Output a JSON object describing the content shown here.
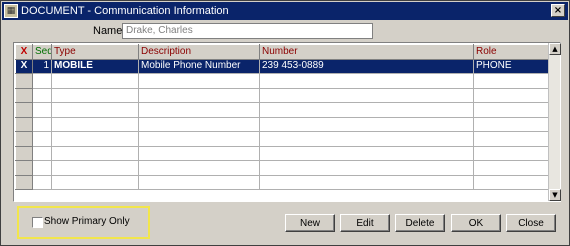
{
  "window": {
    "title": "DOCUMENT - Communication Information",
    "close": "×"
  },
  "name": {
    "label": "Name",
    "value": "Drake, Charles"
  },
  "grid": {
    "columns": {
      "x": "X",
      "seq": "Seq",
      "type": "Type",
      "description": "Description",
      "number": "Number",
      "role": "Role"
    },
    "rows": [
      {
        "x": "X",
        "seq": "1",
        "type": "MOBILE",
        "description": "Mobile Phone Number",
        "number": "239 453-0889",
        "role": "PHONE"
      }
    ],
    "empty_row_count": 8
  },
  "scrollbar": {
    "up": "▲",
    "down": "▼"
  },
  "options": {
    "show_primary_only": {
      "label": "Show Primary Only",
      "checked": false
    }
  },
  "buttons": {
    "new": "New",
    "edit": "Edit",
    "delete": "Delete",
    "ok": "OK",
    "close": "Close"
  },
  "colors": {
    "selected_row": "#0a246a",
    "title_bar": "#0a246a",
    "highlight": "#f2e64b"
  }
}
